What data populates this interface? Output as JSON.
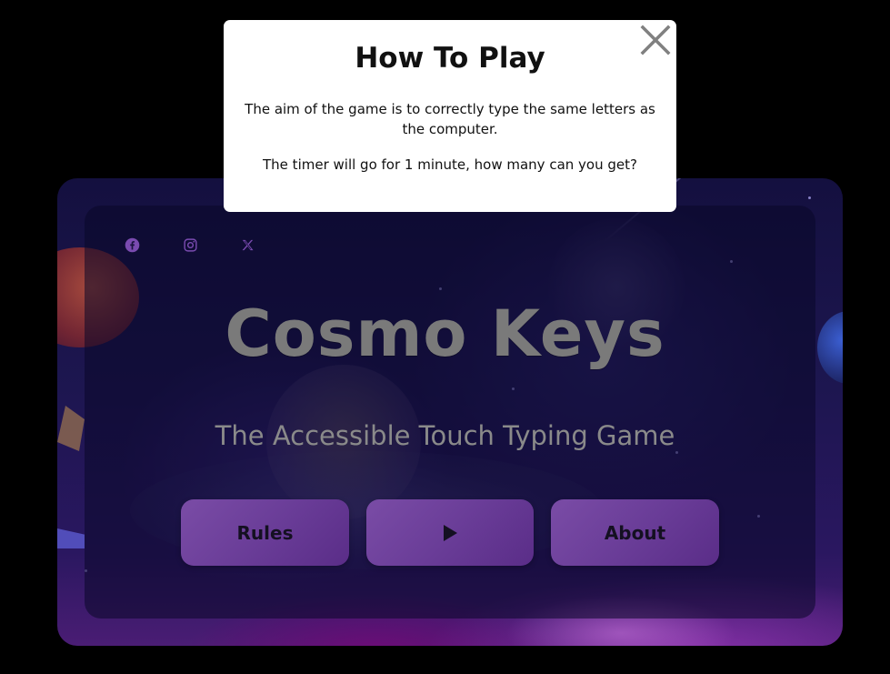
{
  "app": {
    "title": "Cosmo Keys",
    "subtitle": "The Accessible Touch Typing Game"
  },
  "social": [
    {
      "icon": "facebook-icon"
    },
    {
      "icon": "instagram-icon"
    },
    {
      "icon": "x-twitter-icon"
    }
  ],
  "buttons": {
    "rules_label": "Rules",
    "play_icon": "play-icon",
    "about_label": "About"
  },
  "modal": {
    "title": "How To Play",
    "paragraph1": "The aim of the game is to correctly type the same letters as the computer.",
    "paragraph2": "The timer will go for 1 minute, how many can you get?",
    "close_icon": "close-icon"
  },
  "colors": {
    "background": "#000000",
    "button": "#6a3d98",
    "title_text": "#7a7a7a",
    "social_icon": "#7a4bb0",
    "modal_bg": "#ffffff"
  }
}
